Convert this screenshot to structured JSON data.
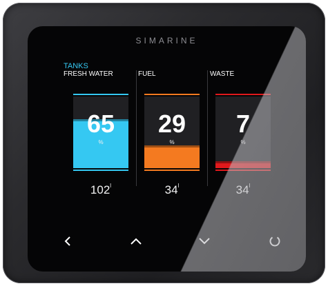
{
  "brand": "SIMARINE",
  "section_title": "TANKS",
  "tanks": [
    {
      "label": "FRESH WATER",
      "level_percent": "65",
      "unit": "%",
      "capacity": "102",
      "capacity_unit": "l",
      "color": "#35c8f2"
    },
    {
      "label": "FUEL",
      "level_percent": "29",
      "unit": "%",
      "capacity": "34",
      "capacity_unit": "l",
      "color": "#f47a20"
    },
    {
      "label": "WASTE",
      "level_percent": "7",
      "unit": "%",
      "capacity": "34",
      "capacity_unit": "l",
      "color": "#e0191c"
    }
  ],
  "nav": {
    "back": "chevron-left-icon",
    "up": "chevron-up-icon",
    "down": "chevron-down-icon",
    "menu": "circle-refresh-icon"
  }
}
